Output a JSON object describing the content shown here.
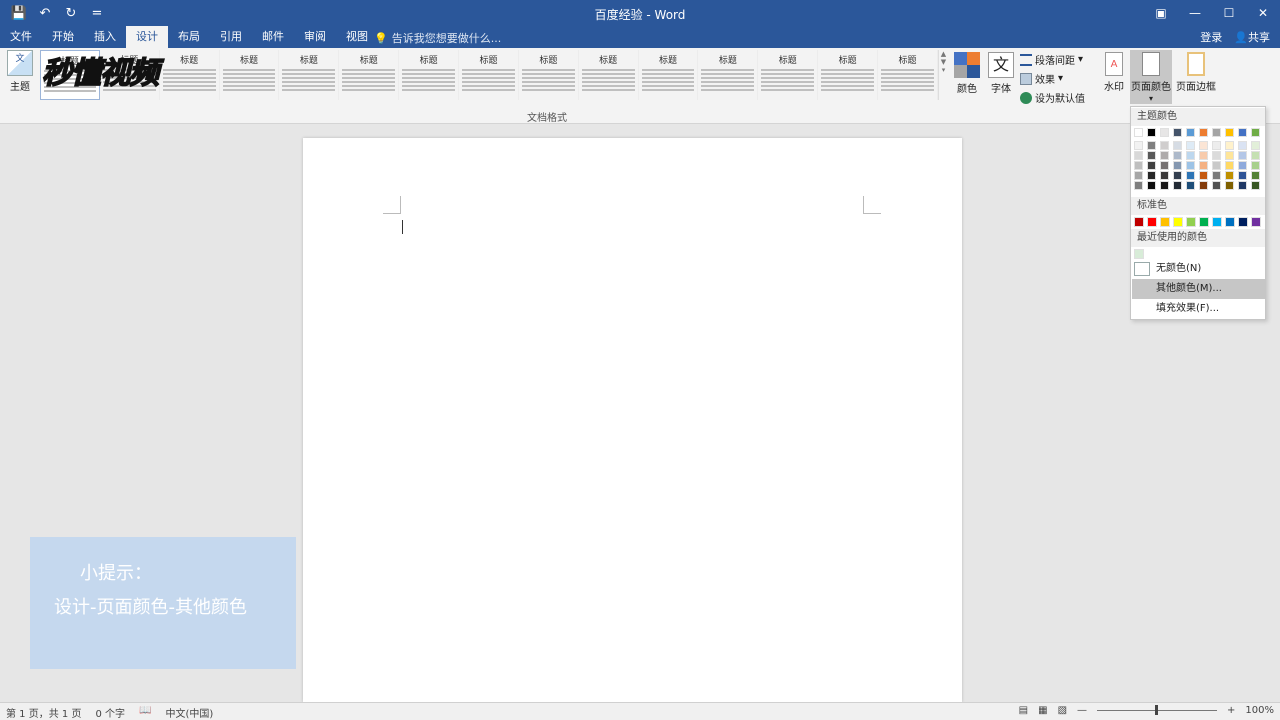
{
  "window": {
    "title": "百度经验 - Word",
    "minimize": "—",
    "maximize": "☐",
    "close": "✕",
    "ribbon_display": "▣"
  },
  "qat": {
    "save": "💾",
    "undo": "↶",
    "redo": "↻",
    "customize": "="
  },
  "tabs": [
    "文件",
    "开始",
    "插入",
    "设计",
    "布局",
    "引用",
    "邮件",
    "审阅",
    "视图"
  ],
  "active_tab": "设计",
  "tell_me": "告诉我您想要做什么...",
  "account": {
    "signin": "登录",
    "share": "共享"
  },
  "ribbon": {
    "theme_label": "主题",
    "gallery_items": [
      {
        "title": "标题"
      },
      {
        "title": "标题"
      },
      {
        "title": "标题"
      },
      {
        "title": "标题"
      },
      {
        "title": "标题"
      },
      {
        "title": "标题"
      },
      {
        "title": "标题"
      },
      {
        "title": "标题"
      },
      {
        "title": "标题"
      },
      {
        "title": "标题"
      },
      {
        "title": "标题"
      },
      {
        "title": "标题"
      },
      {
        "title": "标题"
      },
      {
        "title": "标题"
      },
      {
        "title": "标题"
      }
    ],
    "group_doc_format": "文档格式",
    "colors_label": "颜色",
    "fonts_label": "字体",
    "font_glyph": "文",
    "paragraph_spacing": "段落间距",
    "effects": "效果",
    "set_default": "设为默认值",
    "watermark": "水印",
    "page_color": "页面颜色",
    "page_borders": "页面边框"
  },
  "logo_text": "秒懂视频",
  "tip": {
    "line1": "小提示：",
    "line2": "设计-页面颜色-其他颜色"
  },
  "dropdown": {
    "theme_colors_header": "主题颜色",
    "standard_colors_header": "标准色",
    "recent_colors_header": "最近使用的颜色",
    "no_color": "无颜色(N)",
    "more_colors": "其他颜色(M)...",
    "fill_effects": "填充效果(F)...",
    "theme_colors": [
      [
        "#ffffff",
        "#f2f2f2",
        "#d9d9d9",
        "#bfbfbf",
        "#a6a6a6",
        "#7f7f7f"
      ],
      [
        "#000000",
        "#7f7f7f",
        "#595959",
        "#404040",
        "#262626",
        "#0d0d0d"
      ],
      [
        "#e7e6e6",
        "#d0cece",
        "#aeabab",
        "#757171",
        "#3a3838",
        "#171616"
      ],
      [
        "#44546a",
        "#d6dce4",
        "#adb9ca",
        "#8497b0",
        "#333f4f",
        "#222a35"
      ],
      [
        "#5b9bd5",
        "#deebf6",
        "#bdd7ee",
        "#9dc3e6",
        "#2e75b5",
        "#1e4e79"
      ],
      [
        "#ed7d31",
        "#fbe5d5",
        "#f7cbac",
        "#f4b183",
        "#c55a11",
        "#833c0b"
      ],
      [
        "#a5a5a5",
        "#ededed",
        "#dbdbdb",
        "#c9c9c9",
        "#7b7b7b",
        "#525252"
      ],
      [
        "#ffc000",
        "#fff2cc",
        "#fee599",
        "#ffd965",
        "#bf9000",
        "#7f6000"
      ],
      [
        "#4472c4",
        "#dae3f3",
        "#b4c7e7",
        "#8faadc",
        "#2f5496",
        "#203864"
      ],
      [
        "#70ad47",
        "#e2efd9",
        "#c5e0b3",
        "#a8d08d",
        "#538135",
        "#375623"
      ]
    ],
    "standard_colors": [
      "#c00000",
      "#ff0000",
      "#ffc000",
      "#ffff00",
      "#92d050",
      "#00b050",
      "#00b0f0",
      "#0070c0",
      "#002060",
      "#7030a0"
    ],
    "recent_colors": [
      "#d8ecd8"
    ]
  },
  "status": {
    "page": "第 1 页，共 1 页",
    "words": "0 个字",
    "language": "中文(中国)",
    "zoom": "100%",
    "zoom_minus": "—",
    "zoom_plus": "+"
  }
}
